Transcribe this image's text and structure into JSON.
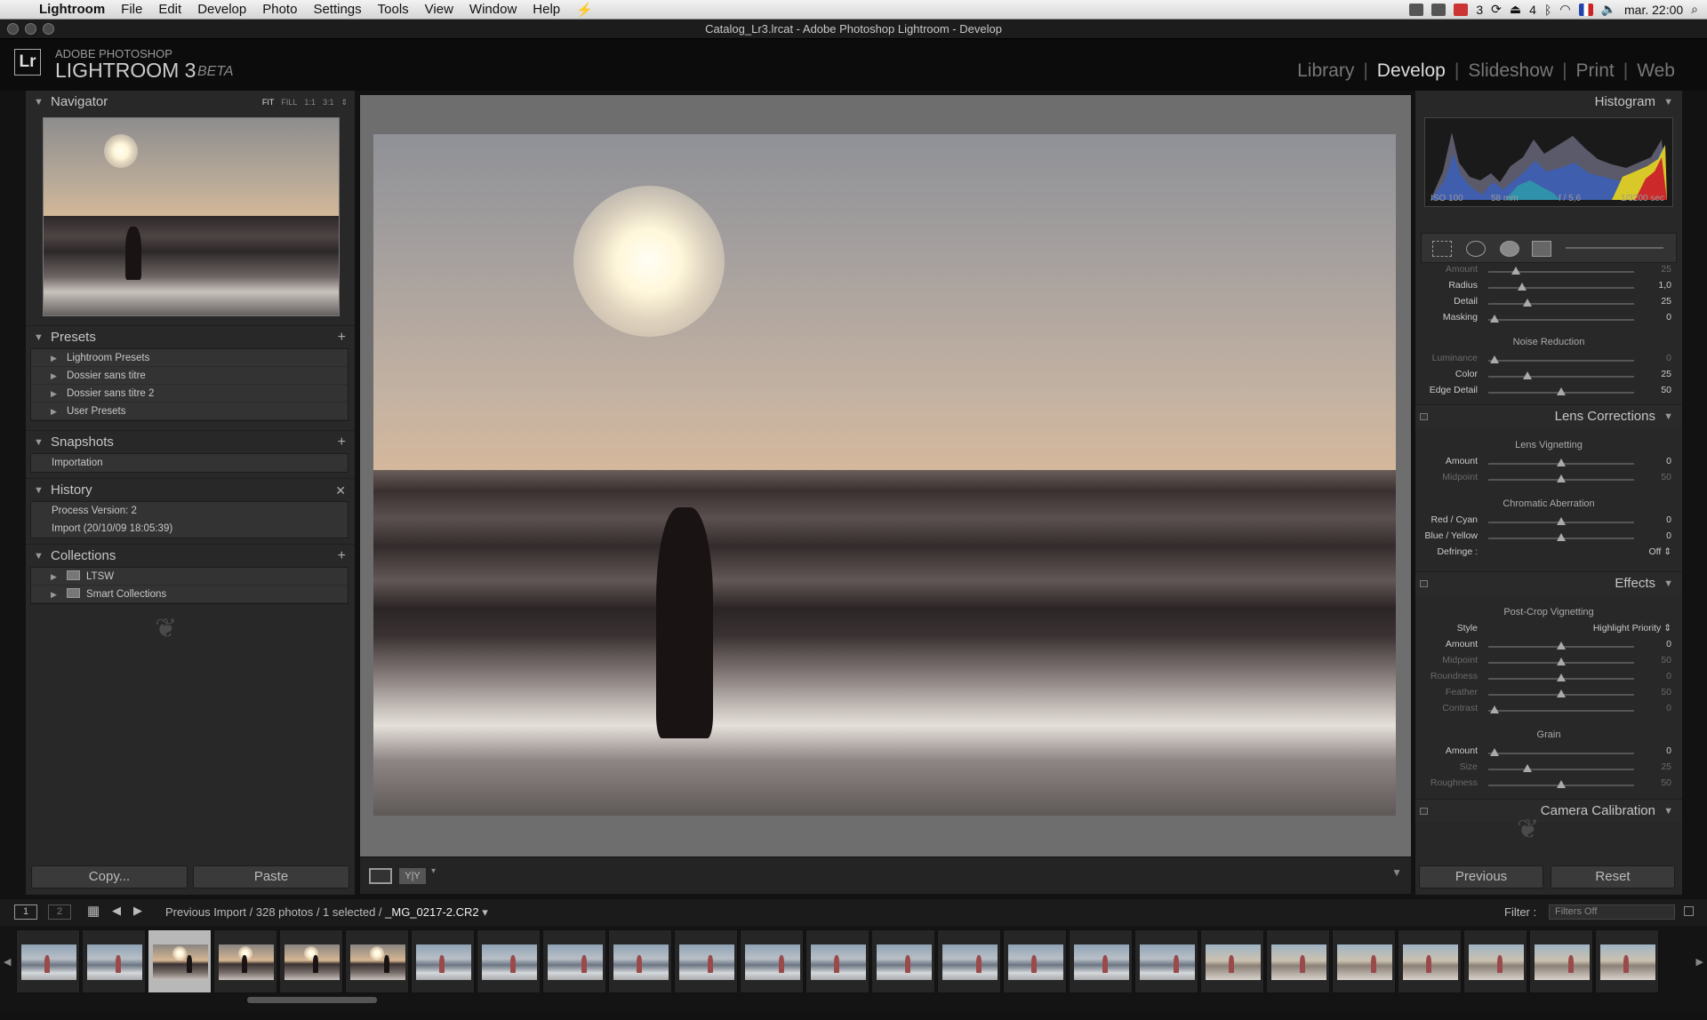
{
  "menubar": {
    "app": "Lightroom",
    "items": [
      "File",
      "Edit",
      "Develop",
      "Photo",
      "Settings",
      "Tools",
      "View",
      "Window",
      "Help"
    ],
    "mail_count": "3",
    "eject_count": "4",
    "clock": "mar. 22:00"
  },
  "window_title": "Catalog_Lr3.lrcat - Adobe Photoshop Lightroom - Develop",
  "brand": {
    "line1": "ADOBE PHOTOSHOP",
    "line2": "LIGHTROOM 3",
    "beta": "BETA",
    "logo": "Lr"
  },
  "modules": [
    "Library",
    "Develop",
    "Slideshow",
    "Print",
    "Web"
  ],
  "active_module": "Develop",
  "left": {
    "navigator": {
      "title": "Navigator",
      "options": [
        "FIT",
        "FILL",
        "1:1",
        "3:1"
      ],
      "active_option": "FIT"
    },
    "presets": {
      "title": "Presets",
      "items": [
        "Lightroom Presets",
        "Dossier sans titre",
        "Dossier sans titre 2",
        "User Presets"
      ]
    },
    "snapshots": {
      "title": "Snapshots",
      "items": [
        "Importation"
      ]
    },
    "history": {
      "title": "History",
      "items": [
        "Process Version: 2",
        "Import (20/10/09 18:05:39)"
      ]
    },
    "collections": {
      "title": "Collections",
      "items": [
        "LTSW",
        "Smart Collections"
      ]
    },
    "copy_label": "Copy...",
    "paste_label": "Paste"
  },
  "right": {
    "histogram_title": "Histogram",
    "exif": {
      "iso": "ISO 100",
      "focal": "58 mm",
      "aperture": "f / 5,6",
      "shutter": "1/3200 sec"
    },
    "detail": {
      "sliders": [
        {
          "label": "Amount",
          "value": "25",
          "pos": 0.19,
          "dim": true
        },
        {
          "label": "Radius",
          "value": "1,0",
          "pos": 0.23,
          "dim": false
        },
        {
          "label": "Detail",
          "value": "25",
          "pos": 0.27,
          "dim": false
        },
        {
          "label": "Masking",
          "value": "0",
          "pos": 0.04,
          "dim": false
        }
      ],
      "noise_title": "Noise Reduction",
      "noise": [
        {
          "label": "Luminance",
          "value": "0",
          "pos": 0.04,
          "dim": true
        },
        {
          "label": "Color",
          "value": "25",
          "pos": 0.27,
          "dim": false
        },
        {
          "label": "Edge Detail",
          "value": "50",
          "pos": 0.5,
          "dim": false
        }
      ]
    },
    "lens": {
      "title": "Lens Corrections",
      "vignetting_title": "Lens Vignetting",
      "vignetting": [
        {
          "label": "Amount",
          "value": "0",
          "pos": 0.5,
          "dim": false
        },
        {
          "label": "Midpoint",
          "value": "50",
          "pos": 0.5,
          "dim": true
        }
      ],
      "ca_title": "Chromatic Aberration",
      "ca": [
        {
          "label": "Red / Cyan",
          "value": "0",
          "pos": 0.5,
          "dim": false
        },
        {
          "label": "Blue / Yellow",
          "value": "0",
          "pos": 0.5,
          "dim": false
        }
      ],
      "defringe_label": "Defringe :",
      "defringe_value": "Off"
    },
    "effects": {
      "title": "Effects",
      "pcv_title": "Post-Crop Vignetting",
      "style_label": "Style",
      "style_value": "Highlight Priority",
      "pcv": [
        {
          "label": "Amount",
          "value": "0",
          "pos": 0.5,
          "dim": false
        },
        {
          "label": "Midpoint",
          "value": "50",
          "pos": 0.5,
          "dim": true
        },
        {
          "label": "Roundness",
          "value": "0",
          "pos": 0.5,
          "dim": true
        },
        {
          "label": "Feather",
          "value": "50",
          "pos": 0.5,
          "dim": true
        },
        {
          "label": "Contrast",
          "value": "0",
          "pos": 0.04,
          "dim": true
        }
      ],
      "grain_title": "Grain",
      "grain": [
        {
          "label": "Amount",
          "value": "0",
          "pos": 0.04,
          "dim": false
        },
        {
          "label": "Size",
          "value": "25",
          "pos": 0.27,
          "dim": true
        },
        {
          "label": "Roughness",
          "value": "50",
          "pos": 0.5,
          "dim": true
        }
      ]
    },
    "calibration_title": "Camera Calibration",
    "previous_label": "Previous",
    "reset_label": "Reset"
  },
  "filmbar": {
    "view1": "1",
    "view2": "2",
    "source": "Previous Import / 328 photos / 1 selected / ",
    "filename": "_MG_0217-2.CR2",
    "filter_label": "Filter :",
    "filter_value": "Filters Off"
  },
  "toolstrip": {
    "compare_label": "Y|Y"
  },
  "film_count": 25,
  "film_selected": 2,
  "colors": {
    "bg": "#282828",
    "accent": "#dddddd"
  }
}
